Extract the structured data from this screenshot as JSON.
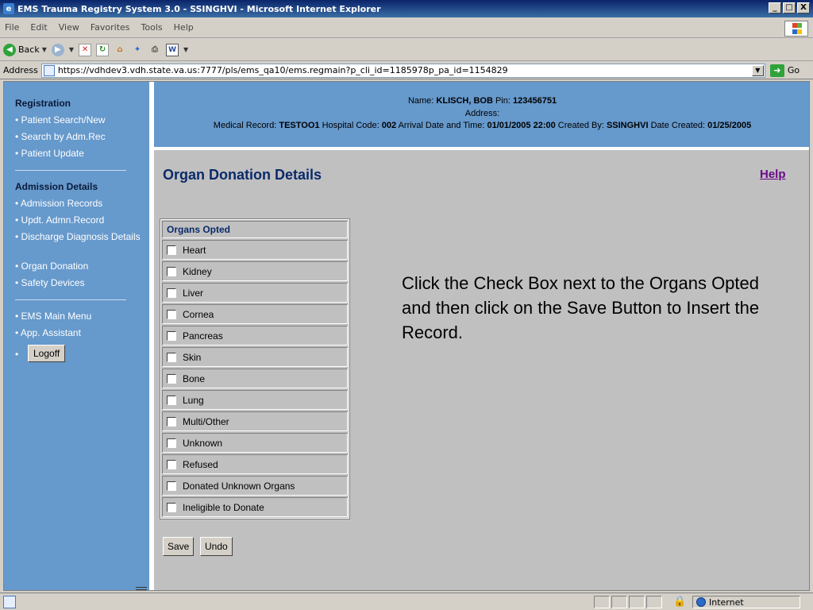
{
  "window": {
    "title": "EMS Trauma Registry System 3.0 - SSINGHVI - Microsoft Internet Explorer",
    "controls": {
      "minimize": "_",
      "maximize": "□",
      "close": "X"
    }
  },
  "menubar": [
    "File",
    "Edit",
    "View",
    "Favorites",
    "Tools",
    "Help"
  ],
  "toolbar": {
    "back_label": "Back"
  },
  "addressbar": {
    "label": "Address",
    "url": "https://vdhdev3.vdh.state.va.us:7777/pls/ems_qa10/ems.regmain?p_cli_id=1185978p_pa_id=1154829",
    "go_label": "Go"
  },
  "sidebar": {
    "registration_heading": "Registration",
    "registration_items": [
      "Patient Search/New",
      "Search by Adm.Rec",
      "Patient Update"
    ],
    "admission_heading": "Admission Details",
    "admission_items": [
      "Admission Records",
      "Updt. Admn.Record",
      "Discharge Diagnosis Details",
      "Organ Donation",
      "Safety Devices"
    ],
    "other_items": [
      "EMS Main Menu",
      "App. Assistant"
    ],
    "logoff_label": "Logoff"
  },
  "patient_header": {
    "name_label": "Name:",
    "name": "KLISCH, BOB",
    "pin_label": "Pin:",
    "pin": "123456751",
    "address_label": "Address:",
    "mr_label": "Medical Record:",
    "mr": "TESTOO1",
    "hospital_label": "Hospital Code:",
    "hospital_code": "002",
    "arrival_label": "Arrival Date and Time:",
    "arrival": "01/01/2005 22:00",
    "created_by_label": "Created By:",
    "created_by": "SSINGHVI",
    "date_created_label": "Date Created:",
    "date_created": "01/25/2005"
  },
  "page": {
    "title": "Organ Donation Details",
    "help_link": "Help"
  },
  "organs": {
    "header": "Organs Opted",
    "items": [
      "Heart",
      "Kidney",
      "Liver",
      "Cornea",
      "Pancreas",
      "Skin",
      "Bone",
      "Lung",
      "Multi/Other",
      "Unknown",
      "Refused",
      "Donated Unknown Organs",
      "Ineligible to Donate"
    ]
  },
  "instruction": "Click the Check Box next to the Organs Opted and then click on the Save Button to Insert the Record.",
  "buttons": {
    "save": "Save",
    "undo": "Undo"
  },
  "statusbar": {
    "zone": "Internet"
  }
}
